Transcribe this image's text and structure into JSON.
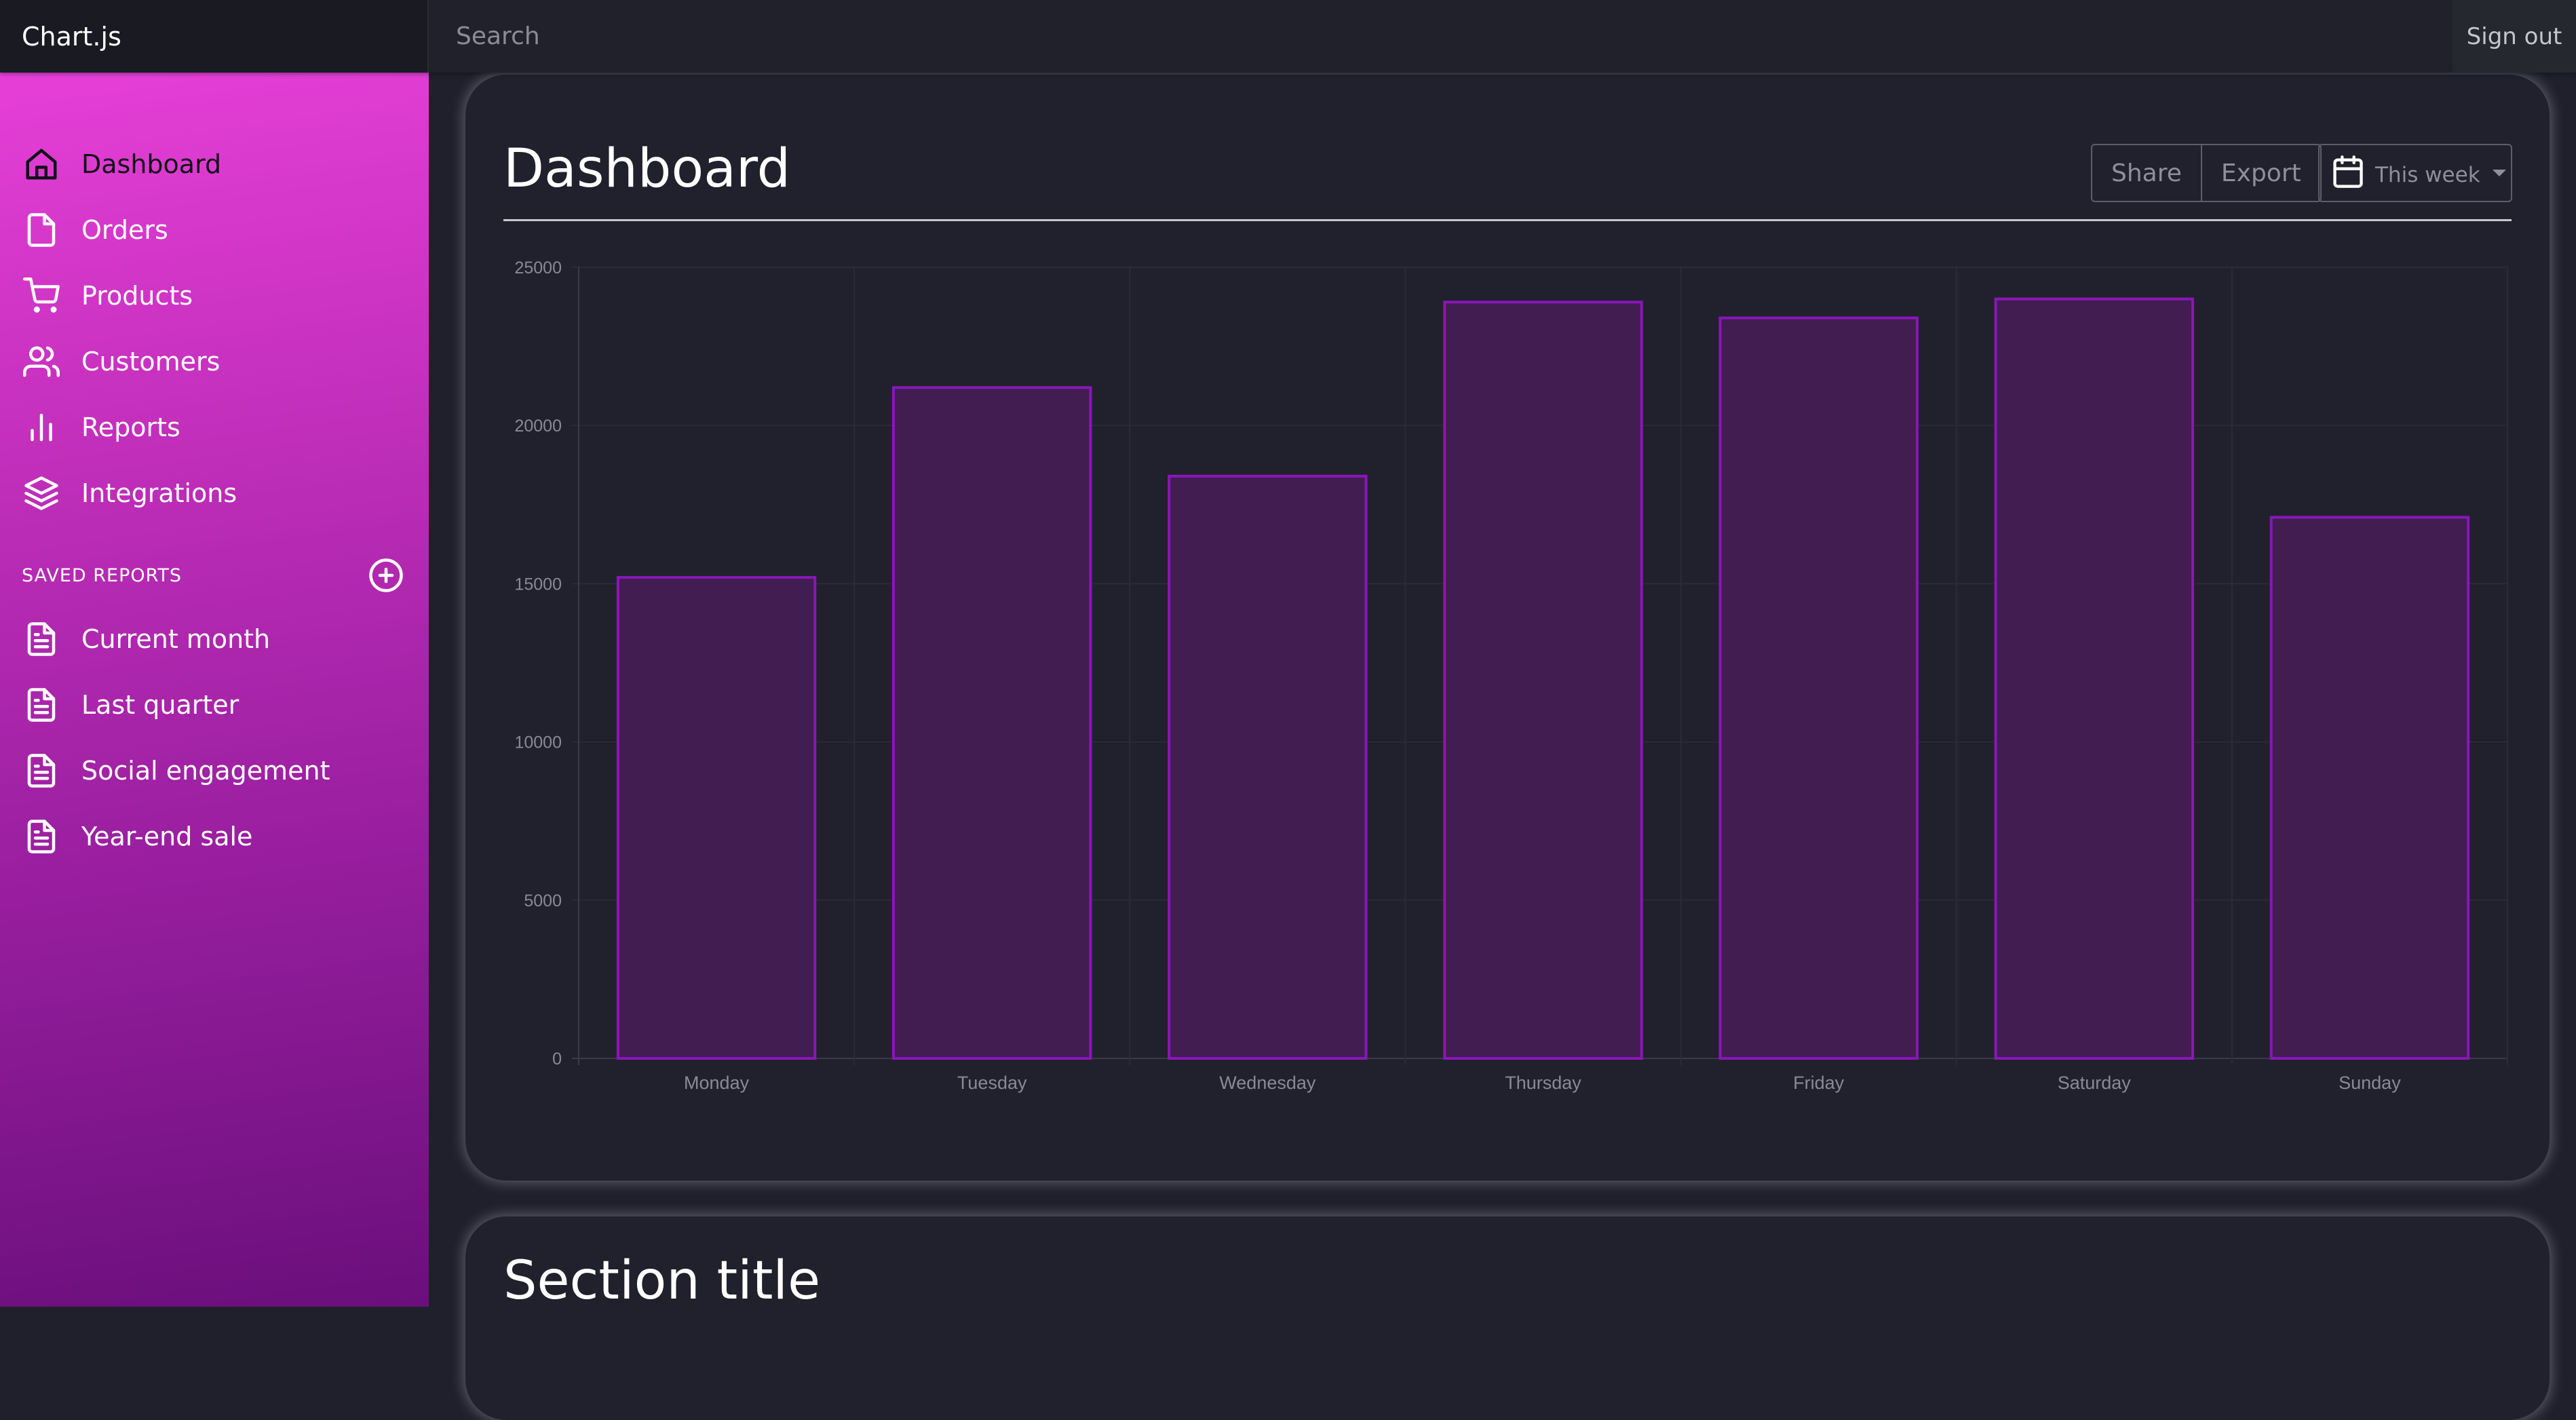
{
  "app": {
    "brand": "Chart.js",
    "signout_label": "Sign out"
  },
  "search": {
    "placeholder": "Search"
  },
  "sidebar": {
    "items": [
      {
        "label": "Dashboard",
        "icon": "home-icon"
      },
      {
        "label": "Orders",
        "icon": "file-icon"
      },
      {
        "label": "Products",
        "icon": "cart-icon"
      },
      {
        "label": "Customers",
        "icon": "users-icon"
      },
      {
        "label": "Reports",
        "icon": "bar-chart-icon"
      },
      {
        "label": "Integrations",
        "icon": "layers-icon"
      }
    ],
    "saved_title": "SAVED REPORTS",
    "saved_reports": [
      {
        "label": "Current month",
        "icon": "file-text-icon"
      },
      {
        "label": "Last quarter",
        "icon": "file-text-icon"
      },
      {
        "label": "Social engagement",
        "icon": "file-text-icon"
      },
      {
        "label": "Year-end sale",
        "icon": "file-text-icon"
      }
    ]
  },
  "main": {
    "title": "Dashboard",
    "share_label": "Share",
    "export_label": "Export",
    "period_label": "This week",
    "section_title": "Section title"
  },
  "colors": {
    "bar_fill": "#411d52",
    "bar_border": "#8a16b8",
    "accent_gradient_top": "#e63fd8",
    "accent_gradient_bottom": "#6a0f7c"
  },
  "chart_data": {
    "type": "bar",
    "categories": [
      "Monday",
      "Tuesday",
      "Wednesday",
      "Thursday",
      "Friday",
      "Saturday",
      "Sunday"
    ],
    "values": [
      15200,
      21200,
      18400,
      23900,
      23400,
      24000,
      17100
    ],
    "ylim": [
      0,
      25000
    ],
    "yticks": [
      0,
      5000,
      10000,
      15000,
      20000,
      25000
    ],
    "title": "",
    "xlabel": "",
    "ylabel": "",
    "grid": true,
    "legend": false
  }
}
